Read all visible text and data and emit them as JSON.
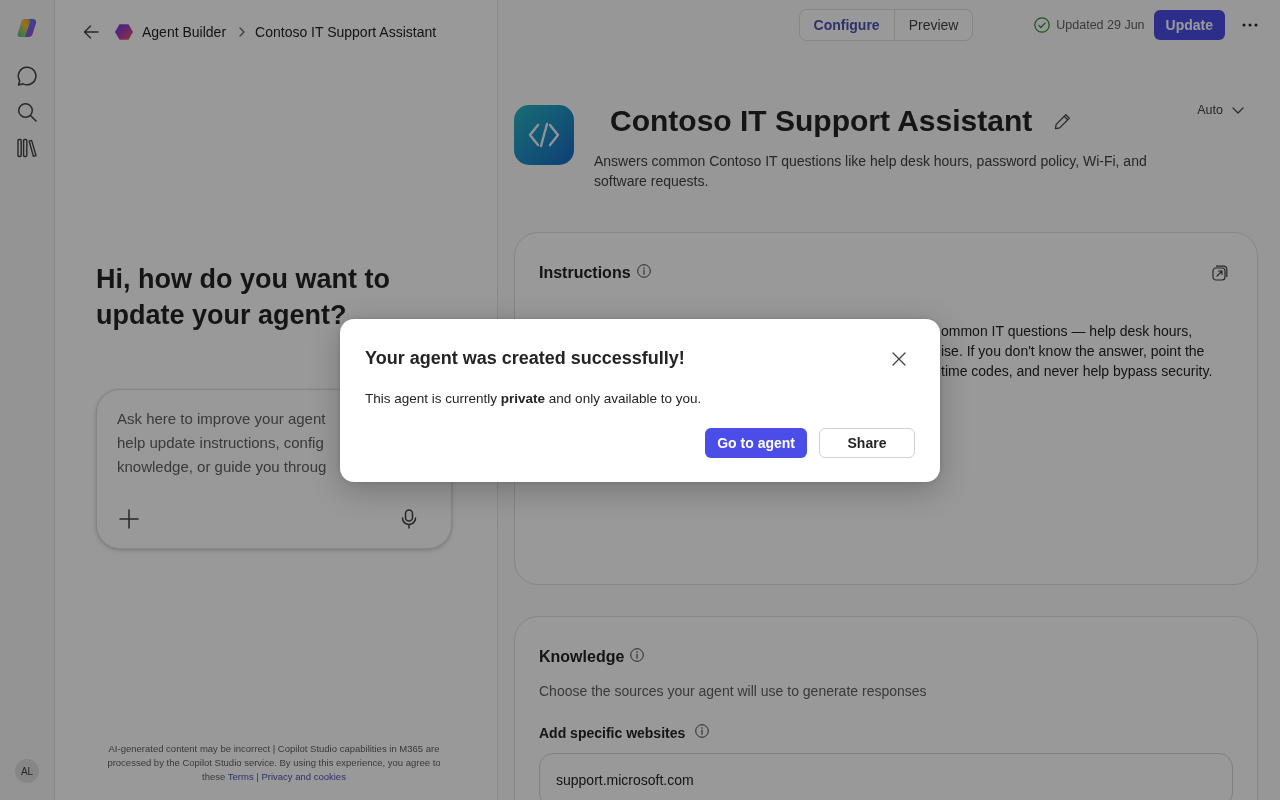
{
  "rail": {
    "avatar_initials": "AL"
  },
  "breadcrumb": [
    "Agent Builder",
    "Contoso IT Support Assistant"
  ],
  "chat_panel": {
    "heading": "Hi, how do you want to update your agent?",
    "input": {
      "placeholder": [
        "Ask here to improve your agent",
        "help update instructions, config",
        "knowledge, or guide you throug"
      ]
    },
    "footer": {
      "text": "AI-generated content may be incorrect | Copilot Studio capabilities in M365 are processed by the Copilot Studio service. By using this experience, you agree to these",
      "links": [
        "Terms",
        "Privacy and cookies"
      ],
      "link_separator": "|"
    }
  },
  "view_tabs": [
    {
      "label": "Configure",
      "selected": true
    },
    {
      "label": "Preview",
      "selected": false
    }
  ],
  "status": {
    "text": "Updated 29 Jun"
  },
  "update_button": {
    "label": "Update"
  },
  "agent": {
    "name": "Contoso IT Support Assistant",
    "description": "Answers common Contoso IT questions like help desk hours, password policy, Wi-Fi, and software requests.",
    "model": "Auto"
  },
  "instructions": {
    "title": "Instructions",
    "visible_lines": [
      "ommon IT questions — help desk hours,",
      "ise. If you don't know the answer, point the",
      "time codes, and never help bypass security."
    ]
  },
  "knowledge": {
    "title": "Knowledge",
    "subtitle": "Choose the sources your agent will use to generate responses",
    "websites": {
      "label": "Add specific websites",
      "value": "support.microsoft.com"
    }
  },
  "dialog": {
    "title": "Your agent was created successfully!",
    "message": "This agent is currently **private** and only available to you.",
    "buttons": [
      {
        "label": "Go to agent",
        "kind": "primary"
      },
      {
        "label": "Share",
        "kind": "secondary"
      }
    ]
  }
}
